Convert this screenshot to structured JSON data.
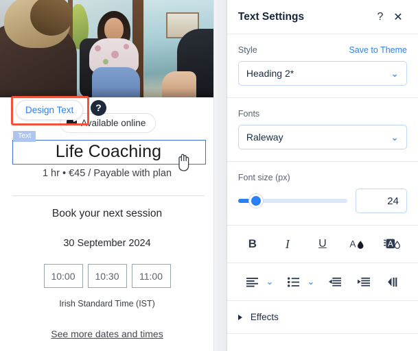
{
  "canvas": {
    "design_text_button": "Design Text",
    "help_icon": "help-circle-icon",
    "available_badge": "Available online",
    "element_tag": "Text",
    "service_title": "Life Coaching",
    "service_meta": "1 hr • €45 / Payable with plan",
    "book_heading": "Book your next session",
    "date": "30 September 2024",
    "time_slots": [
      "10:00",
      "10:30",
      "11:00"
    ],
    "timezone": "Irish Standard Time (IST)",
    "more_link": "See more dates and times",
    "selection_color": "#3b6fd4",
    "highlight_color": "#f0533c",
    "tag_color": "#aec6ef"
  },
  "panel": {
    "title": "Text Settings",
    "help_icon": "question-mark-icon",
    "help_glyph": "?",
    "close_icon": "close-icon",
    "close_glyph": "✕",
    "style": {
      "label": "Style",
      "save_link": "Save to Theme",
      "value": "Heading 2*",
      "chevron": "⌄"
    },
    "fonts": {
      "label": "Fonts",
      "value": "Raleway",
      "chevron": "⌄"
    },
    "font_size": {
      "label": "Font size (px)",
      "value": "24",
      "slider_percent": 13
    },
    "format_toolbar": [
      {
        "name": "bold-icon",
        "glyph": "B"
      },
      {
        "name": "italic-icon",
        "glyph": "I"
      },
      {
        "name": "underline-icon",
        "glyph": "U"
      },
      {
        "name": "text-color-icon",
        "glyph": "A"
      },
      {
        "name": "highlight-color-icon",
        "glyph": "A"
      }
    ],
    "paragraph_toolbar": [
      {
        "name": "align-icon",
        "glyph": "≡"
      },
      {
        "name": "chevron-down-icon",
        "glyph": "⌄"
      },
      {
        "name": "bullet-list-icon",
        "glyph": "☰"
      },
      {
        "name": "chevron-down-icon",
        "glyph": "⌄"
      },
      {
        "name": "outdent-icon",
        "glyph": "◀"
      },
      {
        "name": "indent-icon",
        "glyph": "▶"
      },
      {
        "name": "text-direction-icon",
        "glyph": "¶"
      }
    ],
    "effects": {
      "label": "Effects",
      "expand_icon": "triangle-right-icon"
    },
    "accent_color": "#2b7ff5",
    "border_color": "#bfd8fb"
  }
}
